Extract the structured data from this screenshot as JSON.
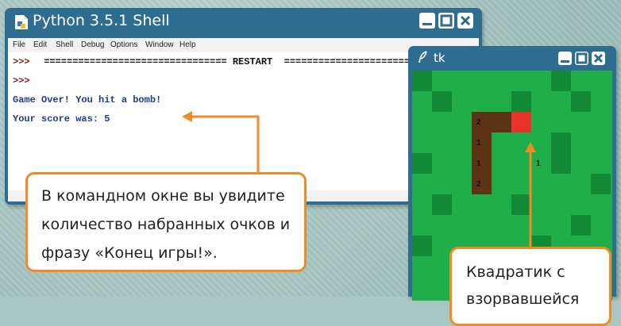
{
  "shell": {
    "title": "Python 3.5.1 Shell",
    "menu": [
      "File",
      "Edit",
      "Shell",
      "Debug",
      "Options",
      "Window",
      "Help"
    ],
    "lines": {
      "prompt1": ">>>",
      "restart": " ================================ RESTART  ================================",
      "prompt2": ">>>",
      "gameover": "Game Over! You hit a bomb!",
      "score": "Your score was: 5"
    }
  },
  "tk": {
    "title": "tk",
    "grid_numbers": [
      "2",
      "1",
      "1",
      "2",
      "1"
    ],
    "colors": {
      "light": "#1fae4a",
      "dark": "#128a35",
      "dug": "#5c3313",
      "bomb": "#e8322b"
    }
  },
  "callouts": {
    "command_window": [
      "В командном окне вы увидите",
      "количество набранных очков и",
      "фразу «Конец игры!»."
    ],
    "bomb_square": [
      "Квадратик с",
      "взорвавшейся"
    ]
  },
  "colors": {
    "accent": "#f08a24",
    "window_frame": "#2e6d8f"
  }
}
